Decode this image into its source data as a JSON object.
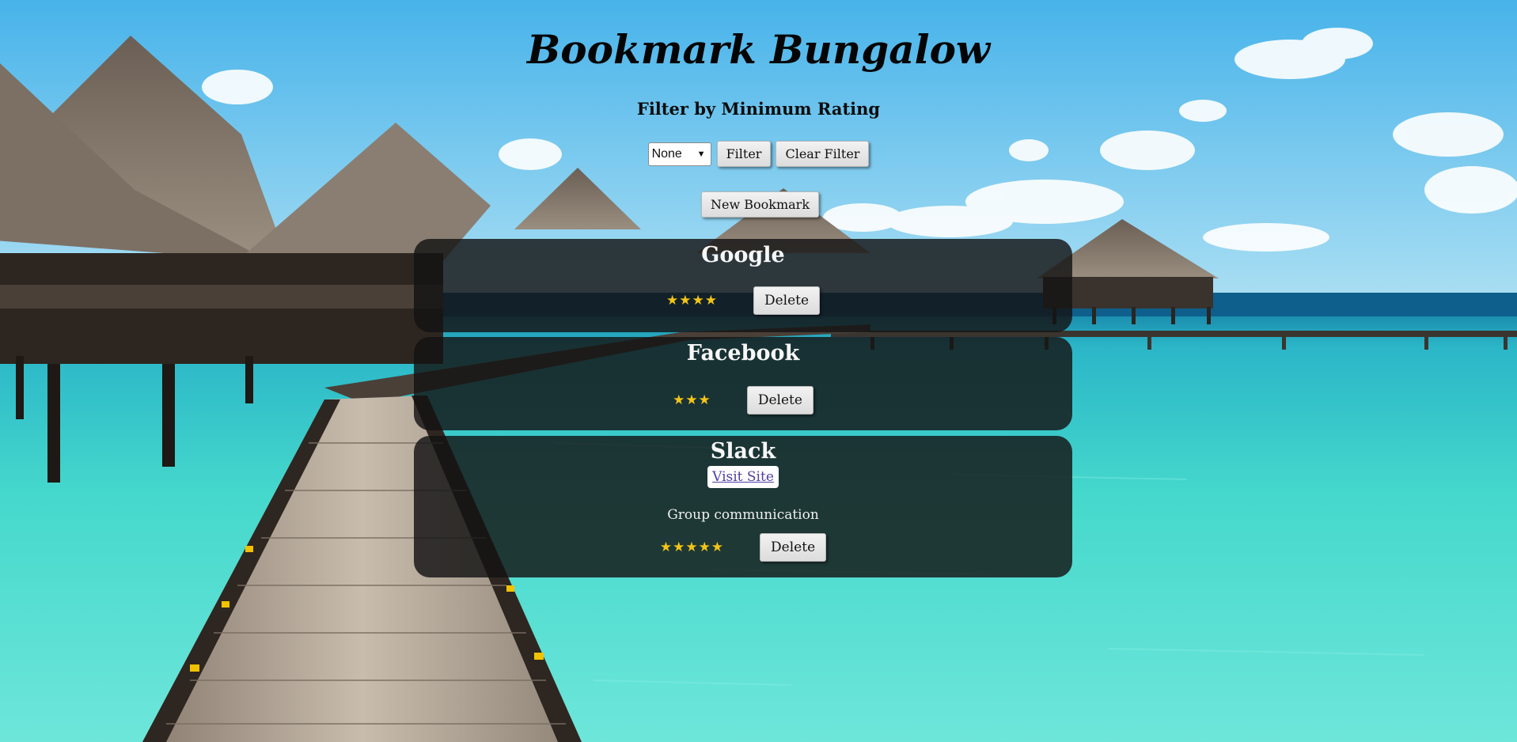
{
  "page": {
    "title": "Bookmark Bungalow"
  },
  "filter": {
    "heading": "Filter by Minimum Rating",
    "select_value": "None",
    "filter_label": "Filter",
    "clear_label": "Clear Filter"
  },
  "actions": {
    "new_bookmark_label": "New Bookmark"
  },
  "bookmarks": [
    {
      "name": "Google",
      "rating": 4,
      "stars": "★★★★",
      "delete_label": "Delete"
    },
    {
      "name": "Facebook",
      "rating": 3,
      "stars": "★★★",
      "delete_label": "Delete"
    },
    {
      "name": "Slack",
      "rating": 5,
      "stars": "★★★★★",
      "link_label": "Visit Site",
      "description": "Group communication",
      "delete_label": "Delete"
    }
  ],
  "colors": {
    "card_background": "#141414",
    "star": "#f3c418",
    "link": "#4d3fa3",
    "sky": "#5ec6e8",
    "water": "#3fd6c9"
  },
  "background": {
    "icon": "tropical-overwater-bungalows-image"
  }
}
